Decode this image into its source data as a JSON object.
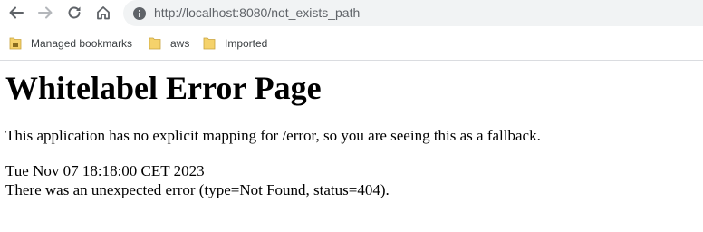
{
  "browser": {
    "url_host": "http://localhost",
    "url_rest": ":8080/not_exists_path",
    "back_icon": "back-arrow-icon",
    "forward_icon": "forward-arrow-icon",
    "reload_icon": "reload-icon",
    "home_icon": "home-icon",
    "site_info_icon": "info-icon"
  },
  "bookmarks": [
    {
      "label": "Managed bookmarks",
      "icon": "managed-folder-icon"
    },
    {
      "label": "aws",
      "icon": "folder-icon"
    },
    {
      "label": "Imported",
      "icon": "folder-icon"
    }
  ],
  "page": {
    "title": "Whitelabel Error Page",
    "description": "This application has no explicit mapping for /error, so you are seeing this as a fallback.",
    "timestamp": "Tue Nov 07 18:18:00 CET 2023",
    "error_message": "There was an unexpected error (type=Not Found, status=404)."
  },
  "colors": {
    "omnibox_bg": "#f1f3f4",
    "folder_yellow": "#f5d26b",
    "icon_gray": "#5f6368"
  }
}
